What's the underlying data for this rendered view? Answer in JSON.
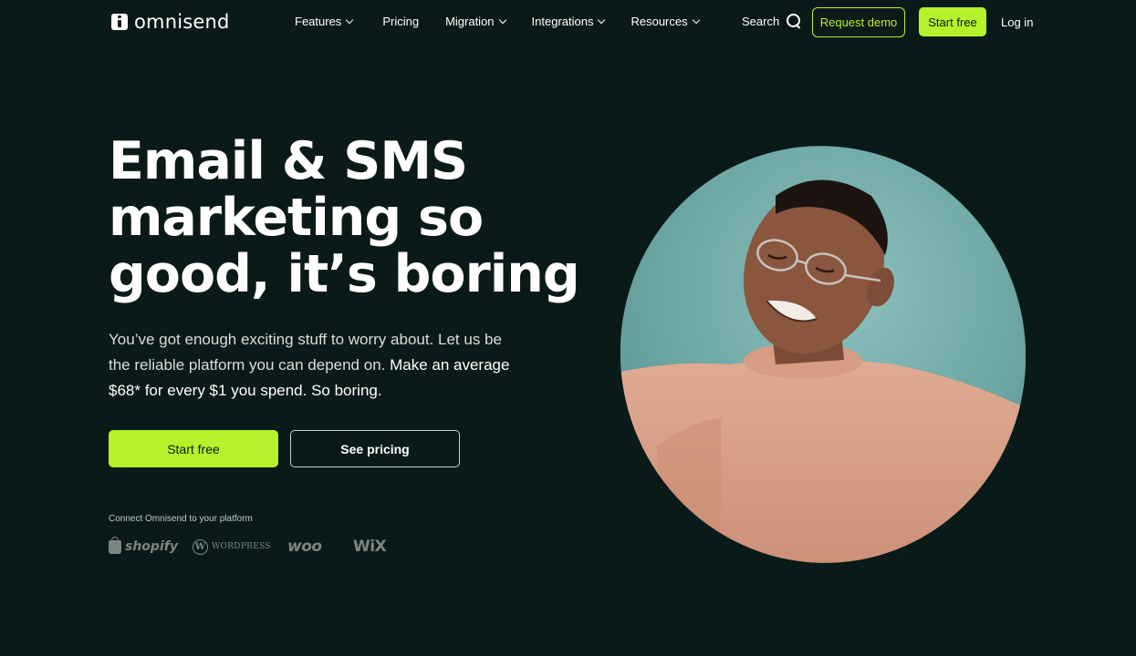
{
  "header": {
    "logo_text": "omnisend",
    "nav": [
      {
        "label": "Features",
        "has_dropdown": true
      },
      {
        "label": "Pricing",
        "has_dropdown": false
      },
      {
        "label": "Migration",
        "has_dropdown": true
      },
      {
        "label": "Integrations",
        "has_dropdown": true
      },
      {
        "label": "Resources",
        "has_dropdown": true
      }
    ],
    "search_label": "Search",
    "request_demo_label": "Request demo",
    "start_free_label": "Start free",
    "login_label": "Log in"
  },
  "hero": {
    "headline_lines": [
      "Email & SMS",
      "marketing so",
      "good, it’s boring"
    ],
    "subtext_plain": "You’ve got enough exciting stuff to worry about. Let us be the reliable platform you can depend on. ",
    "subtext_strong": "Make an average $68* for every $1 you spend. So boring.",
    "cta_primary": "Start free",
    "cta_secondary": "See pricing",
    "connect_label": "Connect Omnisend to your platform",
    "platforms": [
      "shopify",
      "WordPress",
      "woo",
      "WiX"
    ]
  },
  "colors": {
    "background": "#0a1a18",
    "accent": "#b5f22b",
    "photo_bg": "#6fa9a6",
    "sweater": "#d9a28a"
  },
  "icons": {
    "logo": "omnisend-logo-icon",
    "search": "search-icon",
    "dropdown": "chevron-down-icon"
  }
}
